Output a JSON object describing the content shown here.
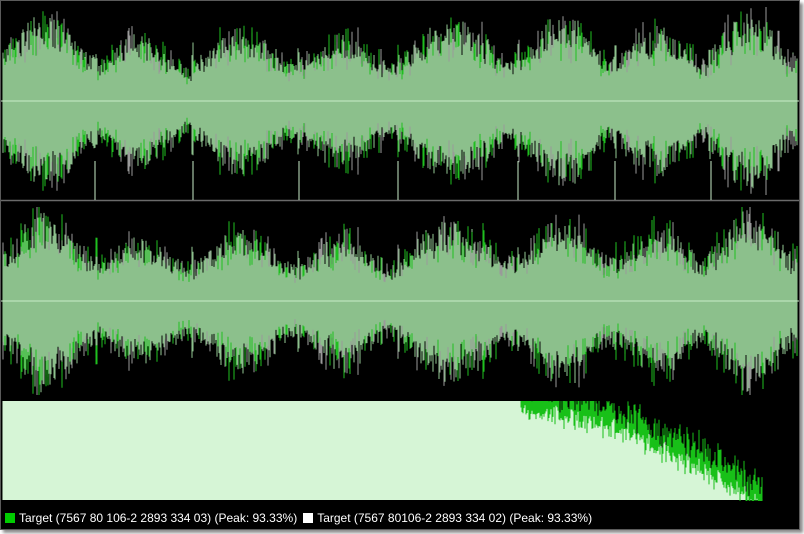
{
  "colors": {
    "background": "#000000",
    "wave_fill": "#8cc08c",
    "wave_green": "#1fbf1f",
    "wave_grey": "#9a9a9a",
    "center_line": "#c8ecc8",
    "divider": "#6a6a6a",
    "bottom_fill": "#d6f5d6",
    "bottom_green": "#18c018",
    "legend_target_1": "#00cc00",
    "legend_target_2": "#ffffff"
  },
  "legend": {
    "items": [
      {
        "label": "Target (7567 80 106-2 2893 334 03) (Peak: 93.33%)",
        "color": "#00cc00"
      },
      {
        "label": "Target (7567 80106-2 2893 334 02) (Peak: 93.33%)",
        "color": "#ffffff"
      }
    ]
  }
}
